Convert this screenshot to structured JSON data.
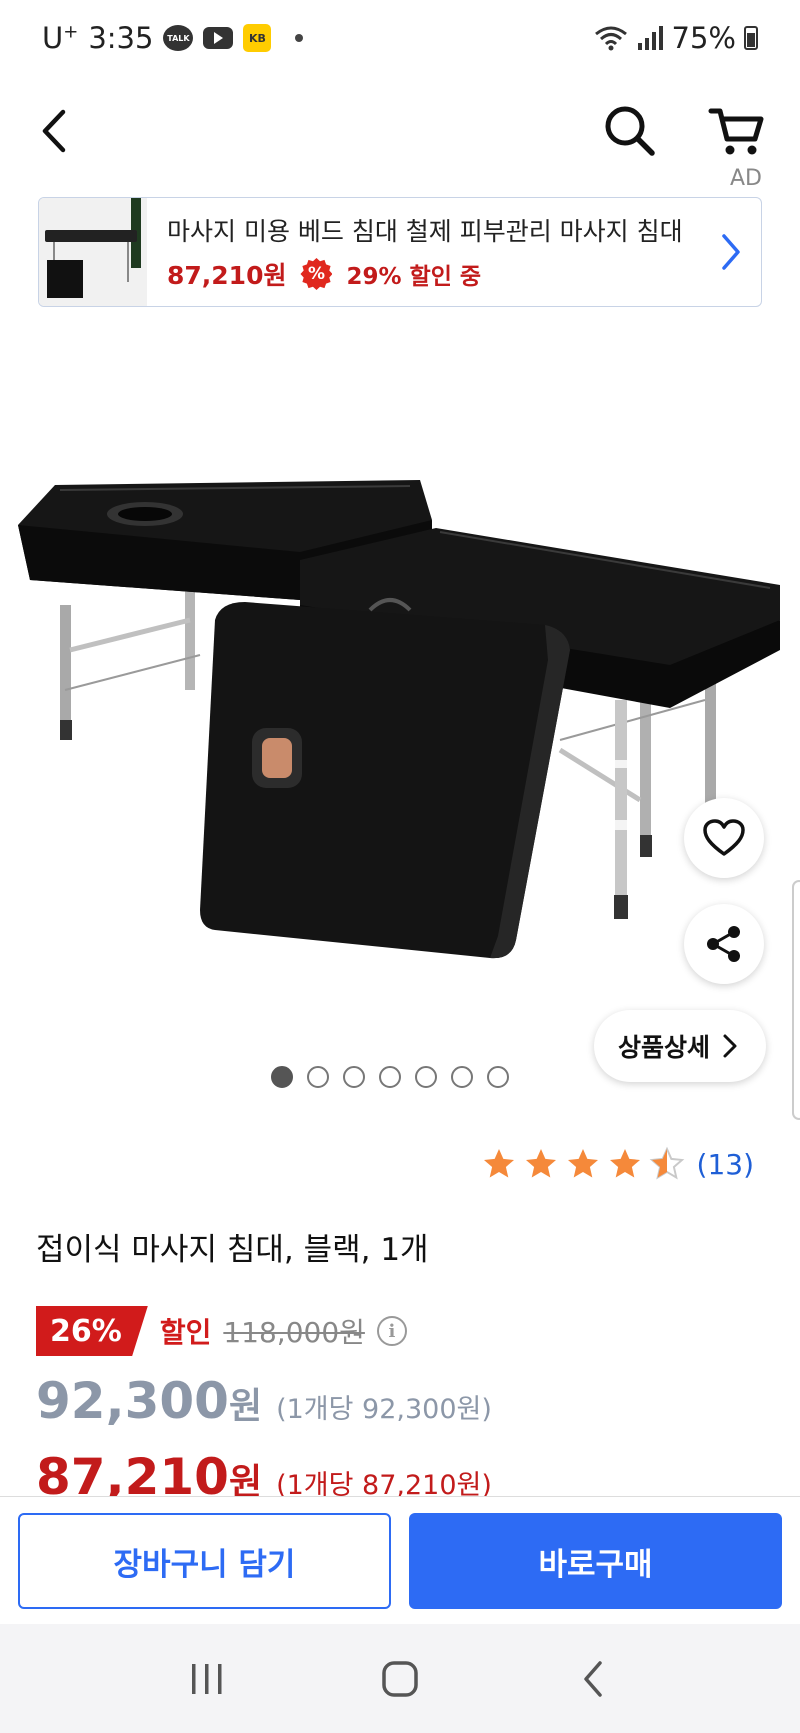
{
  "status_bar": {
    "carrier": "U",
    "carrier_sup": "+",
    "time": "3:35",
    "battery": "75%",
    "icons": [
      "talk-icon",
      "youtube-icon",
      "kb-app-icon",
      "notification-dot-icon",
      "wifi-icon",
      "signal-icon",
      "battery-icon"
    ]
  },
  "top_nav": {
    "ad_label": "AD",
    "icons": [
      "back-arrow-icon",
      "search-icon",
      "cart-icon"
    ]
  },
  "ad_banner": {
    "title": "마사지 미용 베드 침대 철제 피부관리 마사지 침대",
    "price": "87,210원",
    "discount_badge": "%",
    "discount_text": "29% 할인 중"
  },
  "product_image": {
    "current_index": 1,
    "total_images": 7,
    "detail_button": "상품상세"
  },
  "rating": {
    "value": 4.5,
    "max": 5,
    "review_count": "(13)"
  },
  "product": {
    "name": "접이식 마사지 침대, 블랙, 1개",
    "discount_rate": "26%",
    "discount_label": "할인",
    "original_price": "118,000원",
    "price": {
      "amount": "92,300",
      "won": "원",
      "unit": "(1개당 92,300원)"
    },
    "card_price": {
      "amount": "87,210",
      "won": "원",
      "unit": "(1개당 87,210원)"
    }
  },
  "actions": {
    "add_to_cart": "장바구니 담기",
    "buy_now": "바로구매"
  },
  "colors": {
    "accent_blue": "#2d6bf4",
    "sale_red": "#c21b1b",
    "star_orange": "#f5893a",
    "muted_gray": "#8c97a8"
  }
}
